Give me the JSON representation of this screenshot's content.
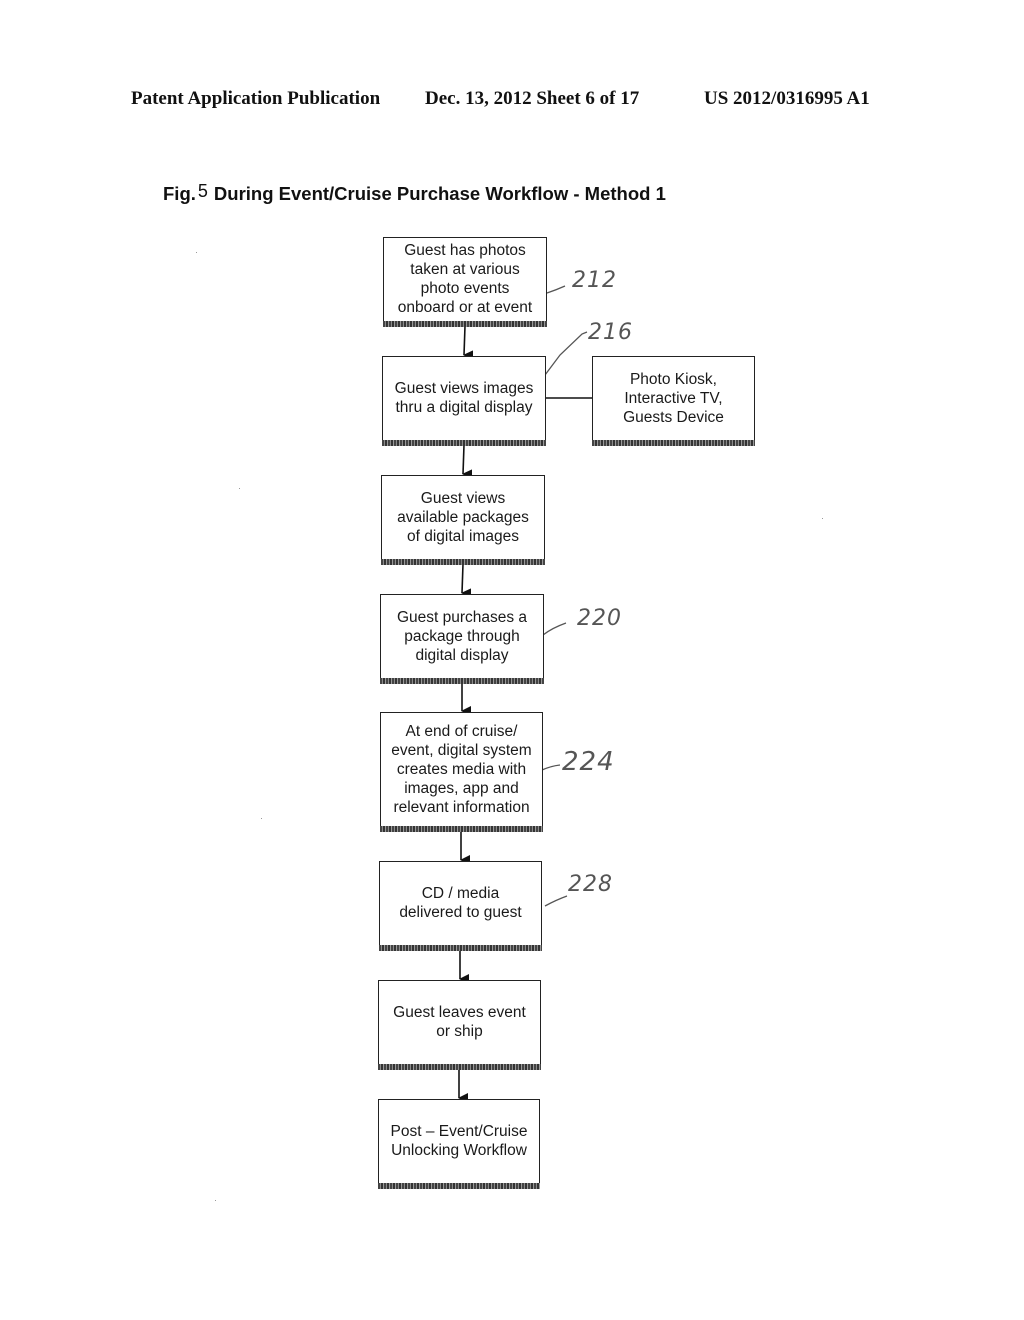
{
  "header": {
    "publication": "Patent Application Publication",
    "date_sheet": "Dec. 13, 2012   Sheet 6 of 17",
    "patent_number": "US 2012/0316995 A1"
  },
  "figure": {
    "label": "Fig.",
    "number": "5",
    "title": "During Event/Cruise Purchase Workflow - Method 1"
  },
  "steps": [
    {
      "text": "Guest has photos\ntaken at various\nphoto events\nonboard or at event",
      "ref": "212"
    },
    {
      "text": "Guest views images\nthru a digital display",
      "ref": "216"
    },
    {
      "text": "Guest views\navailable packages\nof digital images",
      "ref": ""
    },
    {
      "text": "Guest purchases a\npackage through\ndigital display",
      "ref": "220"
    },
    {
      "text": "At end of cruise/\nevent, digital system\ncreates media with\nimages, app and\nrelevant information",
      "ref": "224"
    },
    {
      "text": "CD / media\ndelivered to guest",
      "ref": "228"
    },
    {
      "text": "Guest leaves event\nor ship",
      "ref": ""
    },
    {
      "text": "Post – Event/Cruise\nUnlocking Workflow",
      "ref": ""
    }
  ],
  "side_box": {
    "text": "Photo Kiosk,\nInteractive TV,\nGuests Device",
    "connected_to_step": 2
  },
  "reference_numerals": {
    "r212": "212",
    "r216": "216",
    "r220": "220",
    "r224": "224",
    "r228": "228"
  }
}
